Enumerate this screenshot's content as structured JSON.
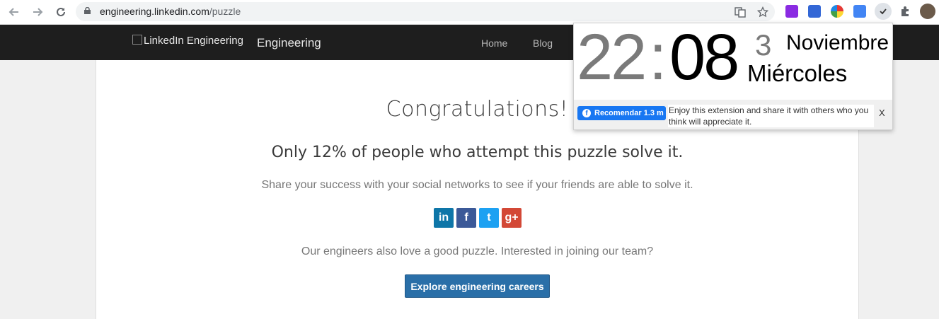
{
  "browser": {
    "url_host": "engineering.linkedin.com",
    "url_path": "/puzzle"
  },
  "header": {
    "logo_alt": "LinkedIn Engineering",
    "brand": "Engineering",
    "nav": [
      "Home",
      "Blog"
    ]
  },
  "main": {
    "title": "Congratulations!",
    "subtitle": "Only 12% of people who attempt this puzzle solve it.",
    "share_text": "Share your success with your social networks to see if your friends are able to solve it.",
    "social": [
      {
        "name": "linkedin",
        "glyph": "in",
        "color": "#0e76a8"
      },
      {
        "name": "facebook",
        "glyph": "f",
        "color": "#3b5998"
      },
      {
        "name": "twitter",
        "glyph": "t",
        "color": "#1da1f2"
      },
      {
        "name": "google-plus",
        "glyph": "g+",
        "color": "#d34836"
      }
    ],
    "join_text": "Our engineers also love a good puzzle. Interested in joining our team?",
    "careers_button": "Explore engineering careers"
  },
  "clock_popup": {
    "hour": "22",
    "colon": ":",
    "minute": "08",
    "day": "3",
    "month": "Noviembre",
    "weekday": "Miércoles",
    "fb_button": "Recomendar 1.3 m",
    "message": "Enjoy this extension and share it with others who you think will appreciate it.",
    "close": "X"
  }
}
